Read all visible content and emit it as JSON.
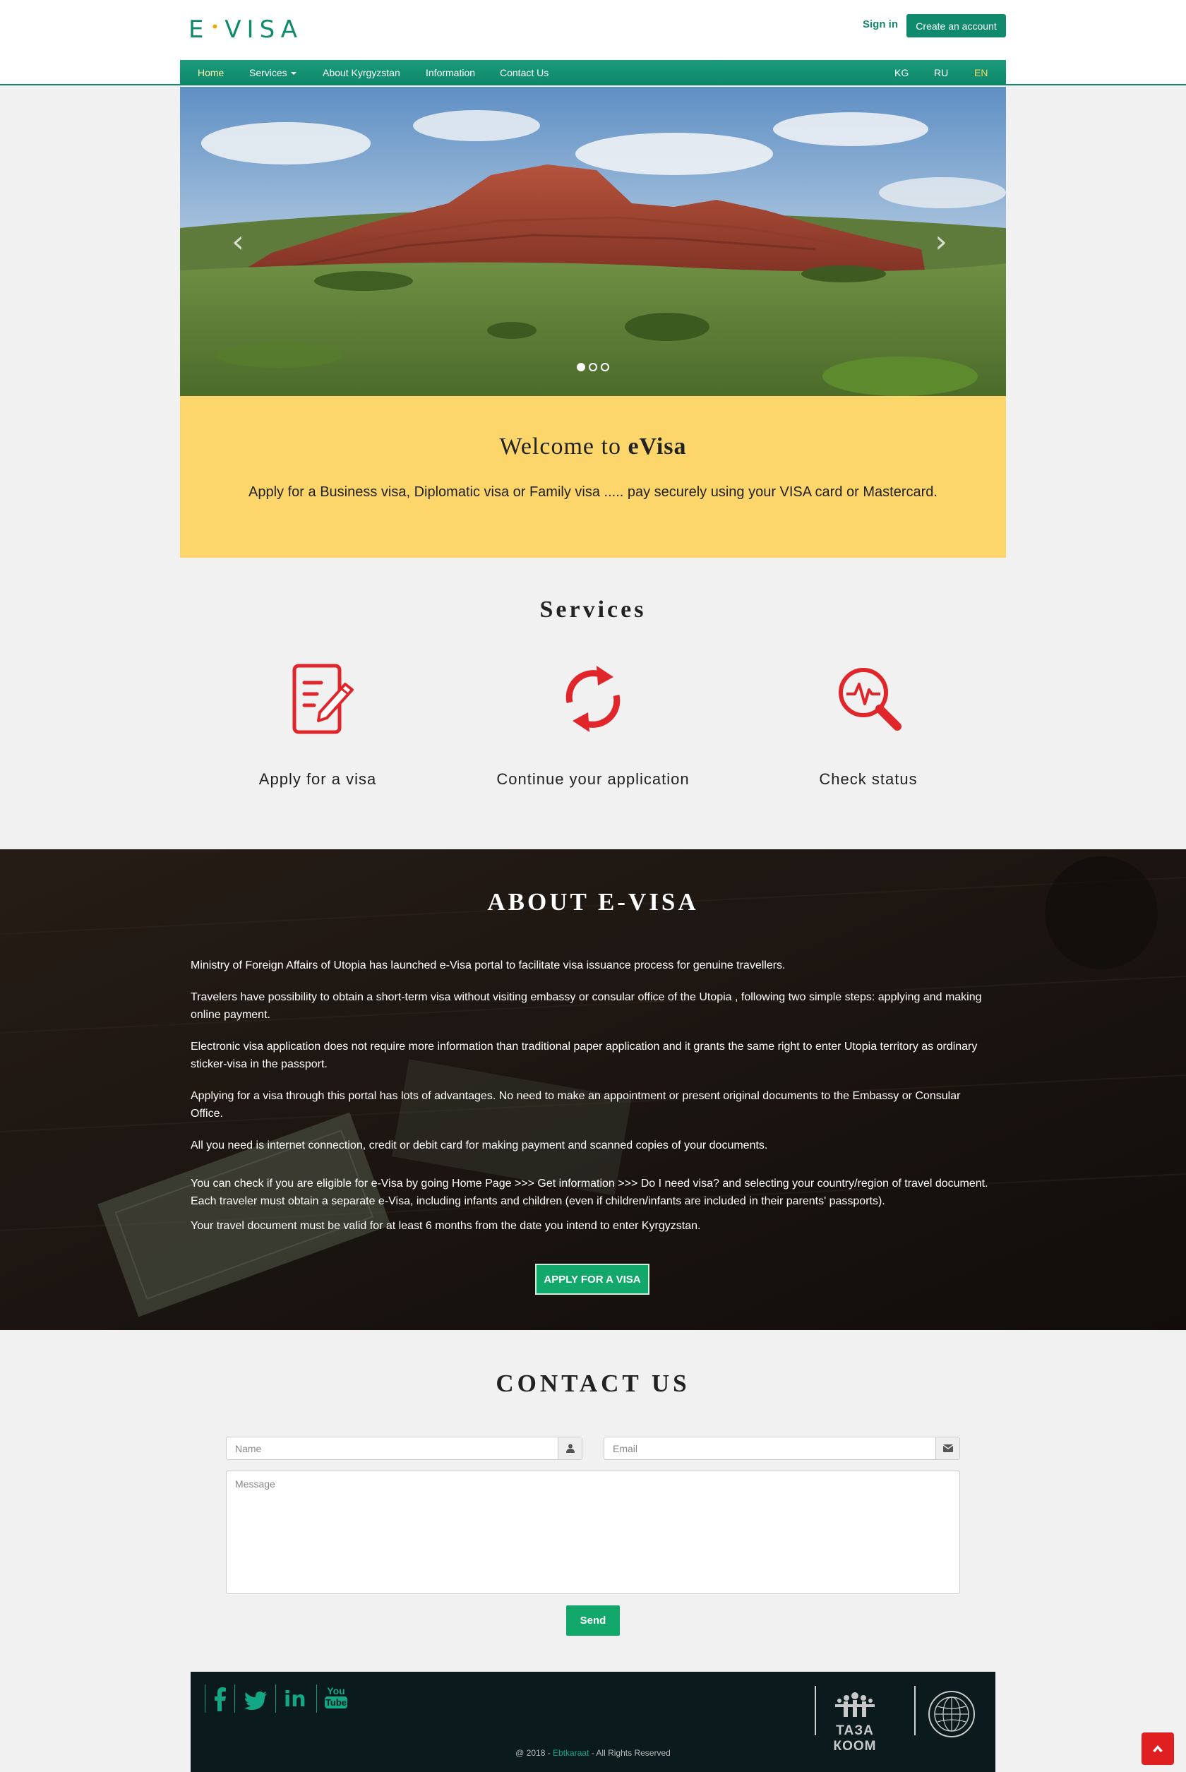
{
  "header": {
    "logo": "E·VISA",
    "logo_left": "E",
    "logo_right": "VISA",
    "sign_in": "Sign in",
    "create_account": "Create an account"
  },
  "nav": {
    "items": [
      "Home",
      "Services",
      "About Kyrgyzstan",
      "Information",
      "Contact Us"
    ],
    "languages": [
      "KG",
      "RU",
      "EN"
    ],
    "active_language": "EN"
  },
  "carousel": {
    "prev_icon": "chevron-left-icon",
    "next_icon": "chevron-right-icon",
    "slide_count": 3,
    "active_slide": 1
  },
  "welcome": {
    "title_prefix": "Welcome to ",
    "title_bold": "eVisa",
    "text": "Apply for a Business visa, Diplomatic visa or Family visa ..... pay securely using your VISA card or Mastercard."
  },
  "services": {
    "title": "Services",
    "items": [
      {
        "label": "Apply for a visa",
        "icon": "document-edit-icon"
      },
      {
        "label": "Continue your application",
        "icon": "refresh-icon"
      },
      {
        "label": "Check status",
        "icon": "search-pulse-icon"
      }
    ]
  },
  "about": {
    "title": "ABOUT E-VISA",
    "paragraphs": [
      "Ministry of Foreign Affairs of Utopia has launched e-Visa portal to facilitate visa issuance process for genuine travellers.",
      "Travelers have possibility to obtain a short-term visa without visiting embassy or consular office of the Utopia , following two simple steps: applying and making online payment.",
      "Electronic visa application does not require more information than traditional paper application and it grants the same right to enter Utopia territory as ordinary sticker-visa in the passport.",
      "Applying for a visa through this portal has lots of advantages. No need to make an appointment or present original documents to the Embassy or Consular Office.",
      "All you need is internet connection, credit or debit card for making payment and scanned copies of your documents.",
      "You can check if you are eligible for e-Visa by going Home Page >>> Get information >>> Do I need visa? and selecting your country/region of travel document. Each traveler must obtain a separate e-Visa, including infants and children (even if children/infants are included in their parents' passports).",
      "Your travel document must be valid for at least 6 months from the date you intend to enter Kyrgyzstan."
    ],
    "apply_button": "APPLY FOR A VISA"
  },
  "contact": {
    "title": "CONTACT US",
    "name_placeholder": "Name",
    "email_placeholder": "Email",
    "message_placeholder": "Message",
    "send": "Send"
  },
  "footer": {
    "social": [
      "facebook-icon",
      "twitter-icon",
      "linkedin-icon",
      "youtube-icon"
    ],
    "youtube_top": "You",
    "youtube_bottom": "Tube",
    "linkedin_text": "in",
    "tazakoom": "ТАЗА КООМ",
    "copyright_prefix": "@ 2018 - ",
    "copyright_link": "Ebtkaraat",
    "copyright_suffix": " - All Rights Reserved"
  },
  "colors": {
    "brand_green": "#0f8a6c",
    "welcome_yellow": "#fdd66b",
    "icon_red": "#e0262b",
    "button_green": "#12a86b",
    "footer_dark": "#0a1a1d"
  }
}
